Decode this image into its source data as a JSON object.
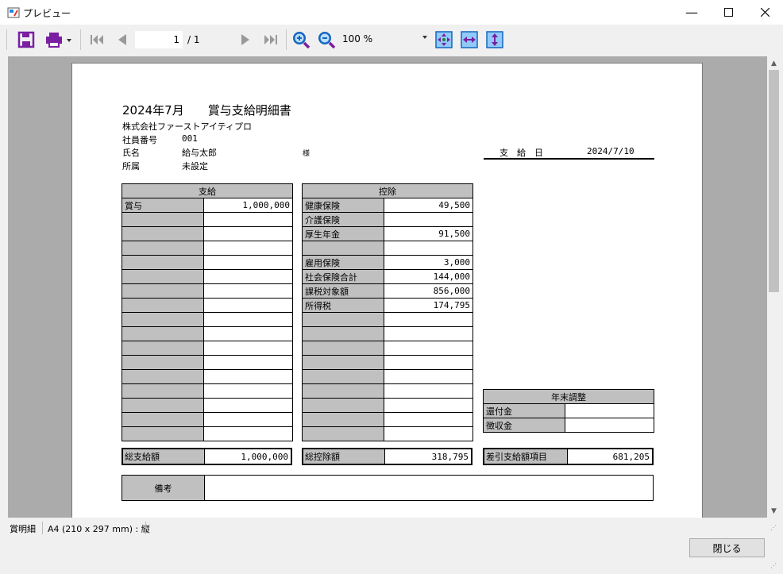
{
  "window": {
    "title": "プレビュー"
  },
  "toolbar": {
    "current_page": "1",
    "total_pages": "/ 1",
    "zoom": "100 %"
  },
  "doc": {
    "title": "2024年7月　　賞与支給明細書",
    "company": "株式会社ファーストアイティプロ",
    "employee_no_label": "社員番号",
    "employee_no": "001",
    "name_label": "氏名",
    "name": "給与太郎",
    "honorific": "様",
    "dept_label": "所属",
    "dept": "未設定",
    "pay_date_label": "支　給　日",
    "pay_date": "2024/7/10",
    "pay": {
      "header": "支給",
      "rows": [
        [
          "賞与",
          "1,000,000"
        ],
        [
          "",
          ""
        ],
        [
          "",
          ""
        ],
        [
          "",
          ""
        ],
        [
          "",
          ""
        ],
        [
          "",
          ""
        ],
        [
          "",
          ""
        ],
        [
          "",
          ""
        ],
        [
          "",
          ""
        ],
        [
          "",
          ""
        ],
        [
          "",
          ""
        ],
        [
          "",
          ""
        ],
        [
          "",
          ""
        ],
        [
          "",
          ""
        ],
        [
          "",
          ""
        ],
        [
          "",
          ""
        ],
        [
          "",
          ""
        ]
      ],
      "total_label": "総支給額",
      "total": "1,000,000"
    },
    "ded": {
      "header": "控除",
      "rows": [
        [
          "健康保険",
          "49,500"
        ],
        [
          "介護保険",
          ""
        ],
        [
          "厚生年金",
          "91,500"
        ],
        [
          "",
          ""
        ],
        [
          "雇用保険",
          "3,000"
        ],
        [
          "社会保険合計",
          "144,000"
        ],
        [
          "課税対象額",
          "856,000"
        ],
        [
          "所得税",
          "174,795"
        ],
        [
          "",
          ""
        ],
        [
          "",
          ""
        ],
        [
          "",
          ""
        ],
        [
          "",
          ""
        ],
        [
          "",
          ""
        ],
        [
          "",
          ""
        ],
        [
          "",
          ""
        ],
        [
          "",
          ""
        ],
        [
          "",
          ""
        ]
      ],
      "total_label": "総控除額",
      "total": "318,795"
    },
    "year_end": {
      "header": "年末調整",
      "rows": [
        [
          "還付金",
          ""
        ],
        [
          "徴収金",
          ""
        ]
      ]
    },
    "net_label": "差引支給額項目",
    "net": "681,205",
    "remarks_label": "備考"
  },
  "status": {
    "report_name": "賞明細",
    "paper": "A4 (210 x 297 mm) : 縦"
  },
  "buttons": {
    "close": "閉じる"
  },
  "colors": {
    "icon_purple": "#7a1fa2",
    "icon_blue": "#1565c0",
    "zoom_green": "#2e7d32"
  }
}
